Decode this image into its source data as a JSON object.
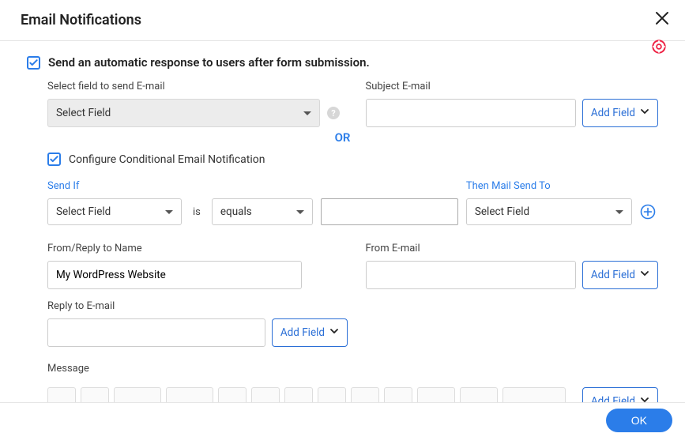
{
  "header": {
    "title": "Email Notifications"
  },
  "main": {
    "send_auto_label": "Send an automatic response to users after form submission.",
    "send_auto_checked": true,
    "field_to_send": {
      "label": "Select field to send E-mail",
      "value": "Select Field"
    },
    "subject": {
      "label": "Subject E-mail",
      "value": "",
      "add_field": "Add Field"
    },
    "or_text": "OR",
    "conditional": {
      "label": "Configure Conditional Email Notification",
      "checked": true,
      "send_if_label": "Send If",
      "field_value": "Select Field",
      "is_text": "is",
      "operator_value": "equals",
      "value_input": "",
      "then_label": "Then Mail Send To",
      "then_value": "Select Field"
    },
    "from_name": {
      "label": "From/Reply to Name",
      "value": "My WordPress Website"
    },
    "from_email": {
      "label": "From E-mail",
      "value": "",
      "add_field": "Add Field"
    },
    "reply_email": {
      "label": "Reply to E-mail",
      "value": "",
      "add_field": "Add Field"
    },
    "message_label": "Message",
    "message_add_field": "Add Field"
  },
  "footer": {
    "ok": "OK"
  }
}
